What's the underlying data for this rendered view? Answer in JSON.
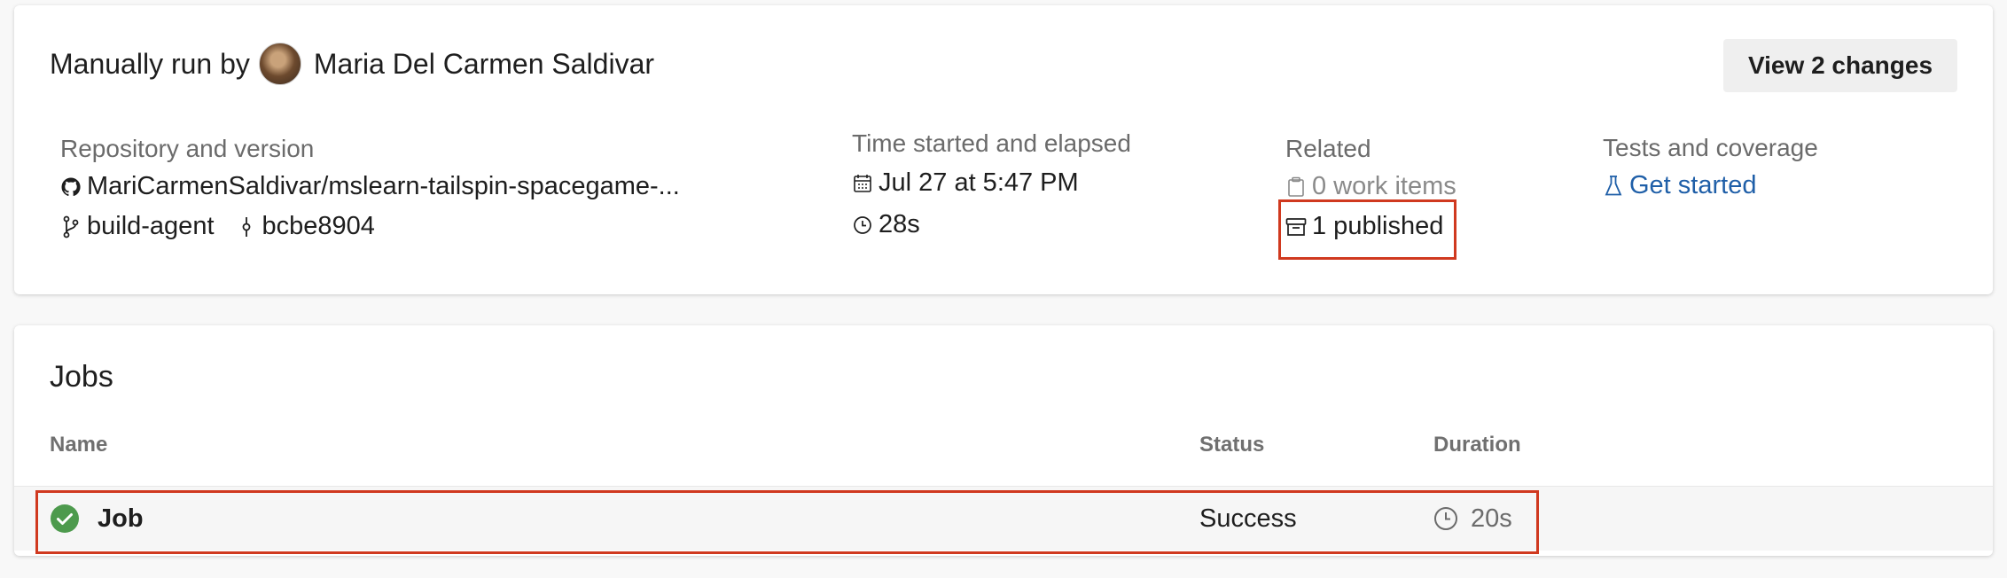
{
  "summary": {
    "title_prefix": "Manually run by",
    "user_name": "Maria Del Carmen Saldivar",
    "view_changes_label": "View 2 changes",
    "repository": {
      "label": "Repository and version",
      "repo_name": "MariCarmenSaldivar/mslearn-tailspin-spacegame-...",
      "branch": "build-agent",
      "commit": "bcbe8904"
    },
    "time": {
      "label": "Time started and elapsed",
      "started": "Jul 27 at 5:47 PM",
      "elapsed": "28s"
    },
    "related": {
      "label": "Related",
      "work_items": "0 work items",
      "published": "1 published"
    },
    "tests": {
      "label": "Tests and coverage",
      "link": "Get started"
    }
  },
  "jobs": {
    "title": "Jobs",
    "columns": {
      "name": "Name",
      "status": "Status",
      "duration": "Duration"
    },
    "rows": [
      {
        "name": "Job",
        "status": "Success",
        "duration": "20s"
      }
    ]
  },
  "colors": {
    "highlight": "#d0391f",
    "success": "#4d9a4d",
    "link": "#1f5fa8"
  },
  "icons": {
    "repo": "github-icon",
    "branch": "branch-icon",
    "commit": "commit-icon",
    "calendar": "calendar-icon",
    "clock": "clock-icon",
    "work_items": "clipboard-icon",
    "published": "artifact-icon",
    "tests": "flask-icon",
    "job_status": "check-circle-icon"
  }
}
